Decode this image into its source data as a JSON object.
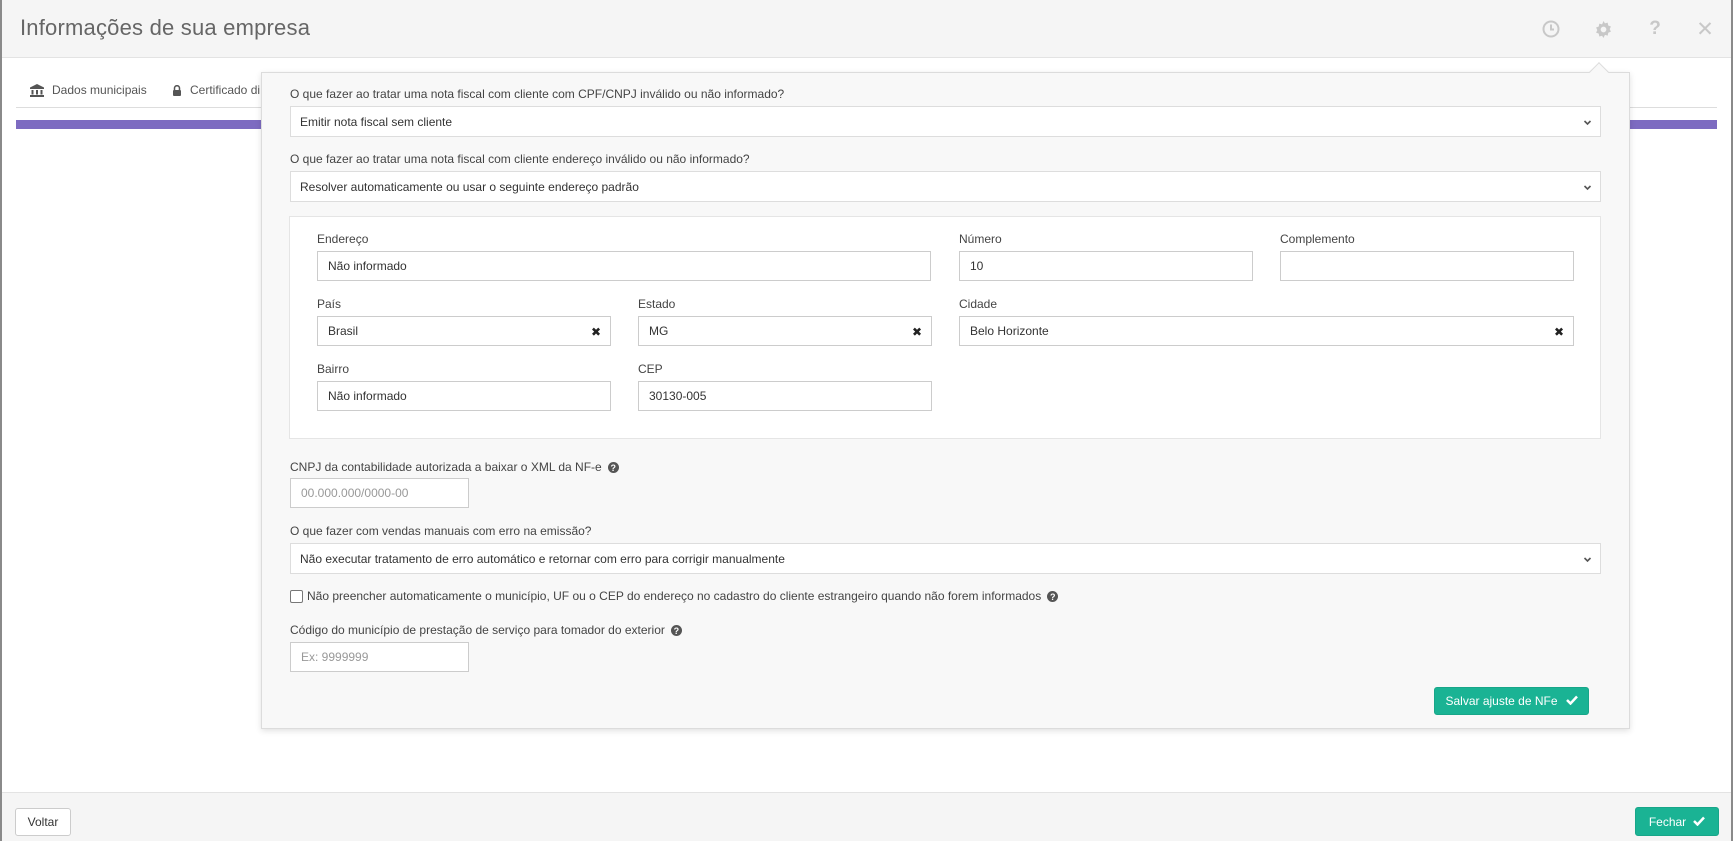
{
  "header": {
    "title": "Informações de sua empresa",
    "icons": [
      "history-icon",
      "gear-icon",
      "help-icon",
      "close-icon"
    ],
    "help_glyph": "?",
    "close_glyph": "✕"
  },
  "tabs": [
    {
      "label": "Dados municipais",
      "icon": "bank-icon"
    },
    {
      "label": "Certificado di",
      "icon": "lock-icon"
    }
  ],
  "colors": {
    "accent": "#1ab394",
    "progress": "#7d6bc1"
  },
  "form": {
    "q_invalid_client_label": "O que fazer ao tratar uma nota fiscal com cliente com CPF/CNPJ inválido ou não informado?",
    "q_invalid_client_value": "Emitir nota fiscal sem cliente",
    "q_invalid_address_label": "O que fazer ao tratar uma nota fiscal com cliente endereço inválido ou não informado?",
    "q_invalid_address_value": "Resolver automaticamente ou usar o seguinte endereço padrão",
    "address": {
      "endereco_label": "Endereço",
      "endereco_value": "Não informado",
      "numero_label": "Número",
      "numero_value": "10",
      "complemento_label": "Complemento",
      "complemento_value": "",
      "pais_label": "País",
      "pais_value": "Brasil",
      "estado_label": "Estado",
      "estado_value": "MG",
      "cidade_label": "Cidade",
      "cidade_value": "Belo Horizonte",
      "bairro_label": "Bairro",
      "bairro_value": "Não informado",
      "cep_label": "CEP",
      "cep_value": "30130-005",
      "clear_glyph": "✖"
    },
    "cnpj_label": "CNPJ da contabilidade autorizada a baixar o XML da NF-e",
    "cnpj_placeholder": "00.000.000/0000-00",
    "q_manual_error_label": "O que fazer com vendas manuais com erro na emissão?",
    "q_manual_error_value": "Não executar tratamento de erro automático e retornar com erro para corrigir manualmente",
    "no_autofill_label": "Não preencher automaticamente o município, UF ou o CEP do endereço no cadastro do cliente estrangeiro quando não forem informados",
    "no_autofill_checked": false,
    "municipio_label": "Código do município de prestação de serviço para tomador do exterior",
    "municipio_placeholder": "Ex: 9999999",
    "help_glyph": "?",
    "save_label": "Salvar ajuste de NFe"
  },
  "footer": {
    "back_label": "Voltar",
    "close_label": "Fechar"
  }
}
